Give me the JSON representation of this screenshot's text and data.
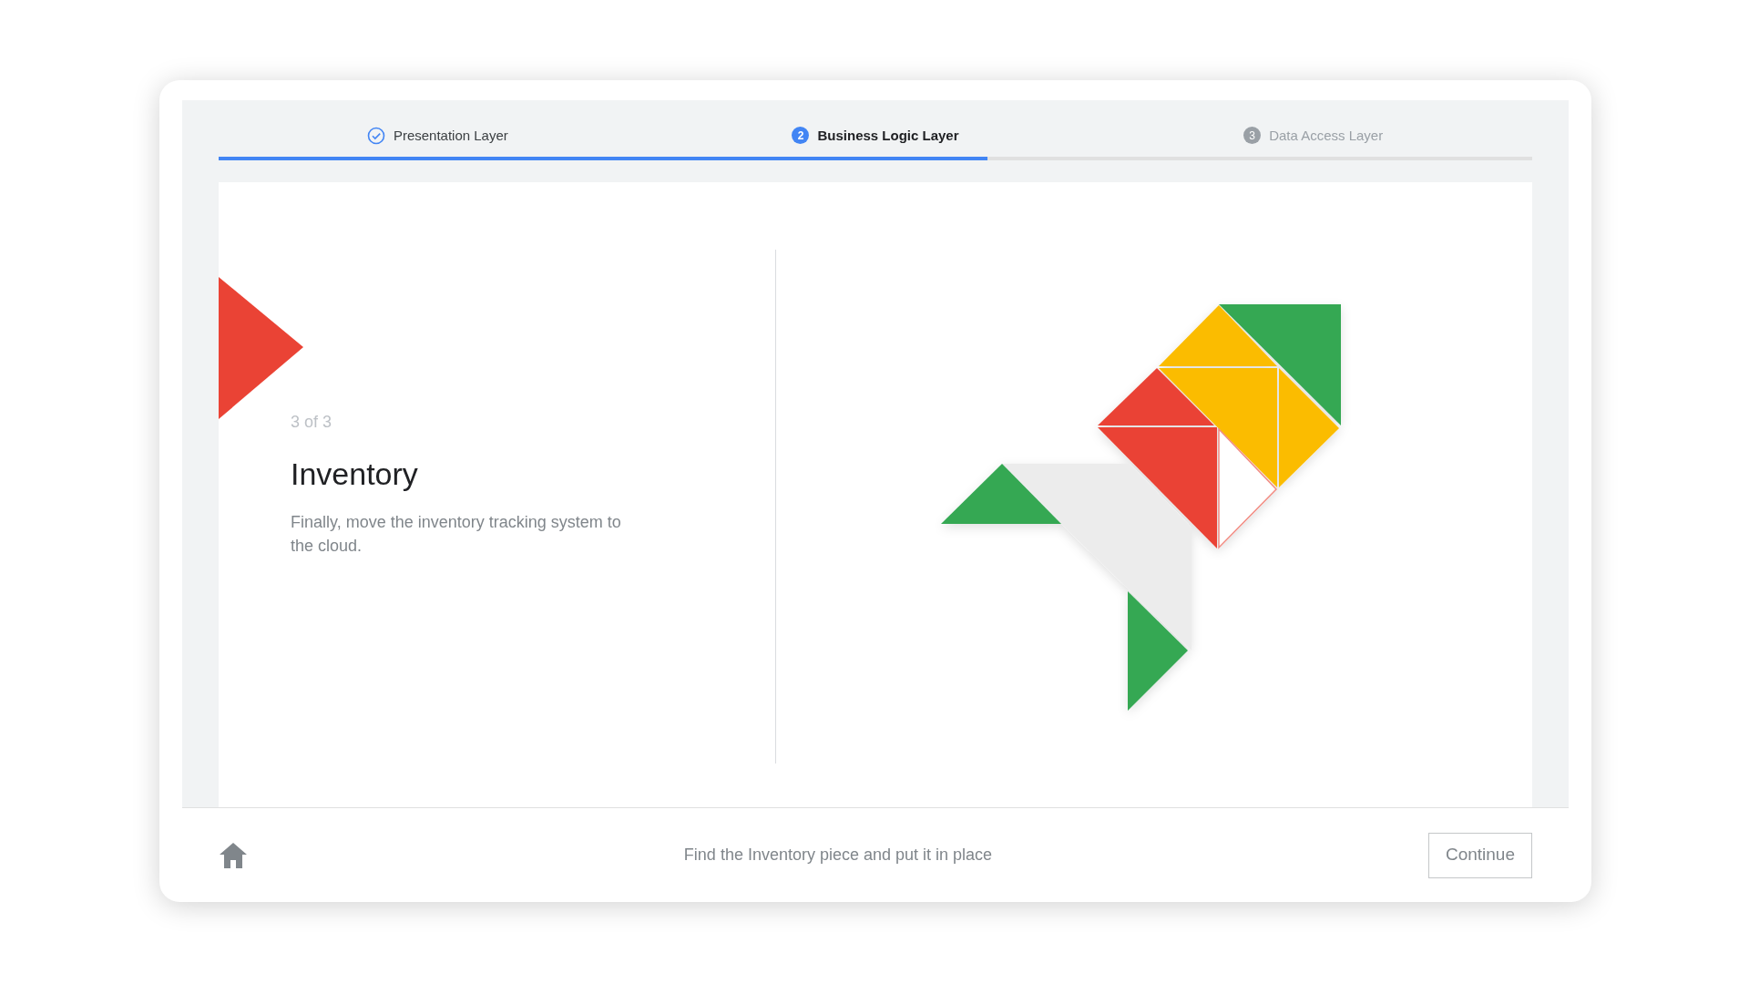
{
  "stepper": {
    "steps": [
      {
        "label": "Presentation Layer",
        "kind": "done",
        "selected": false
      },
      {
        "label": "Business Logic Layer",
        "number": "2",
        "kind": "current",
        "selected": true
      },
      {
        "label": "Data Access Layer",
        "number": "3",
        "kind": "upcoming",
        "selected": false
      }
    ],
    "level": 0.585
  },
  "slide": {
    "counter": "3 of 3",
    "title": "Inventory",
    "description": "Finally, move the inventory tracking system to the cloud."
  },
  "footer": {
    "instruction": "Find the Inventory piece and put it in place",
    "button": "Continue"
  }
}
